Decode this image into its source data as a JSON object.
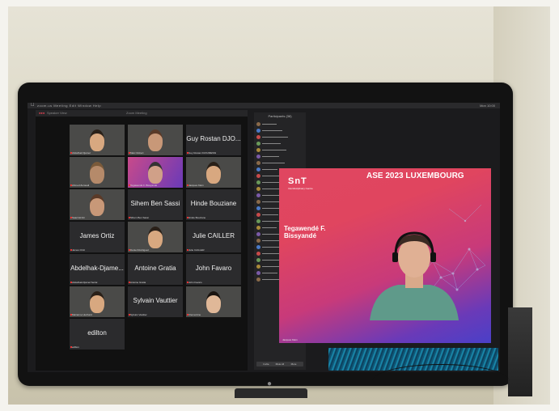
{
  "menubar": {
    "apple_glyph": "",
    "items": "zoom.us   Meeting   Edit   Window   Help",
    "clock": "Mon 10:00"
  },
  "zoom": {
    "title_left": "Speaker View",
    "title_center": "Zoom Meeting",
    "participants": [
      {
        "name": "",
        "caption": "Abdelhak Djamel",
        "has_video": true
      },
      {
        "name": "",
        "caption": "Marc Robert",
        "has_video": true
      },
      {
        "name": "Guy Rostan DJO...",
        "caption": "Guy Rostan DJOUMESSI",
        "has_video": false
      },
      {
        "name": "",
        "caption": "Ahmed Zerouali",
        "has_video": true
      },
      {
        "name": "",
        "caption": "Tegawendé F. Bissyandé",
        "has_video": true
      },
      {
        "name": "",
        "caption": "Jacques Klein",
        "has_video": true
      },
      {
        "name": "",
        "caption": "Saad Ezzini",
        "has_video": true
      },
      {
        "name": "Sihem Ben Sassi",
        "caption": "Sihem Ben Sassi",
        "has_video": false
      },
      {
        "name": "Hinde Bouziane",
        "caption": "Hinde Bouziane",
        "has_video": false
      },
      {
        "name": "James Ortiz",
        "caption": "James Ortiz",
        "has_video": false
      },
      {
        "name": "",
        "caption": "Daniel Rodriguez",
        "has_video": true
      },
      {
        "name": "Julie CAILLER",
        "caption": "Julie CAILLER",
        "has_video": false
      },
      {
        "name": "Abdelhak-Djame...",
        "caption": "Abdelhak-Djamel Seriai",
        "has_video": false
      },
      {
        "name": "Antoine Gratia",
        "caption": "Antoine Gratia",
        "has_video": false
      },
      {
        "name": "John Favaro",
        "caption": "John Favaro",
        "has_video": false
      },
      {
        "name": "",
        "caption": "Marianne Huchard",
        "has_video": true
      },
      {
        "name": "Sylvain Vauttier",
        "caption": "Sylvain Vauttier",
        "has_video": false
      },
      {
        "name": "",
        "caption": "Clementine",
        "has_video": true
      },
      {
        "name": "edilton",
        "caption": "edilton",
        "has_video": false
      }
    ],
    "participants_panel": {
      "header": "Participants (38)",
      "count": 25,
      "buttons": [
        "Invite",
        "Mute All",
        "More"
      ]
    }
  },
  "slide": {
    "logo": "SnT",
    "logo_sub": "Interdisciplinary Centre",
    "conference": "ASE 2023 LUXEMBOURG",
    "speaker_line1": "Tegawendé F.",
    "speaker_line2": "Bissyandé",
    "cam_caption": "Jacques Klein"
  },
  "colors": {
    "slide_red": "#e04660",
    "slide_purple": "#6a3ab8",
    "zoom_tile": "#2b2b2d",
    "wall": "#e2dfcd"
  }
}
